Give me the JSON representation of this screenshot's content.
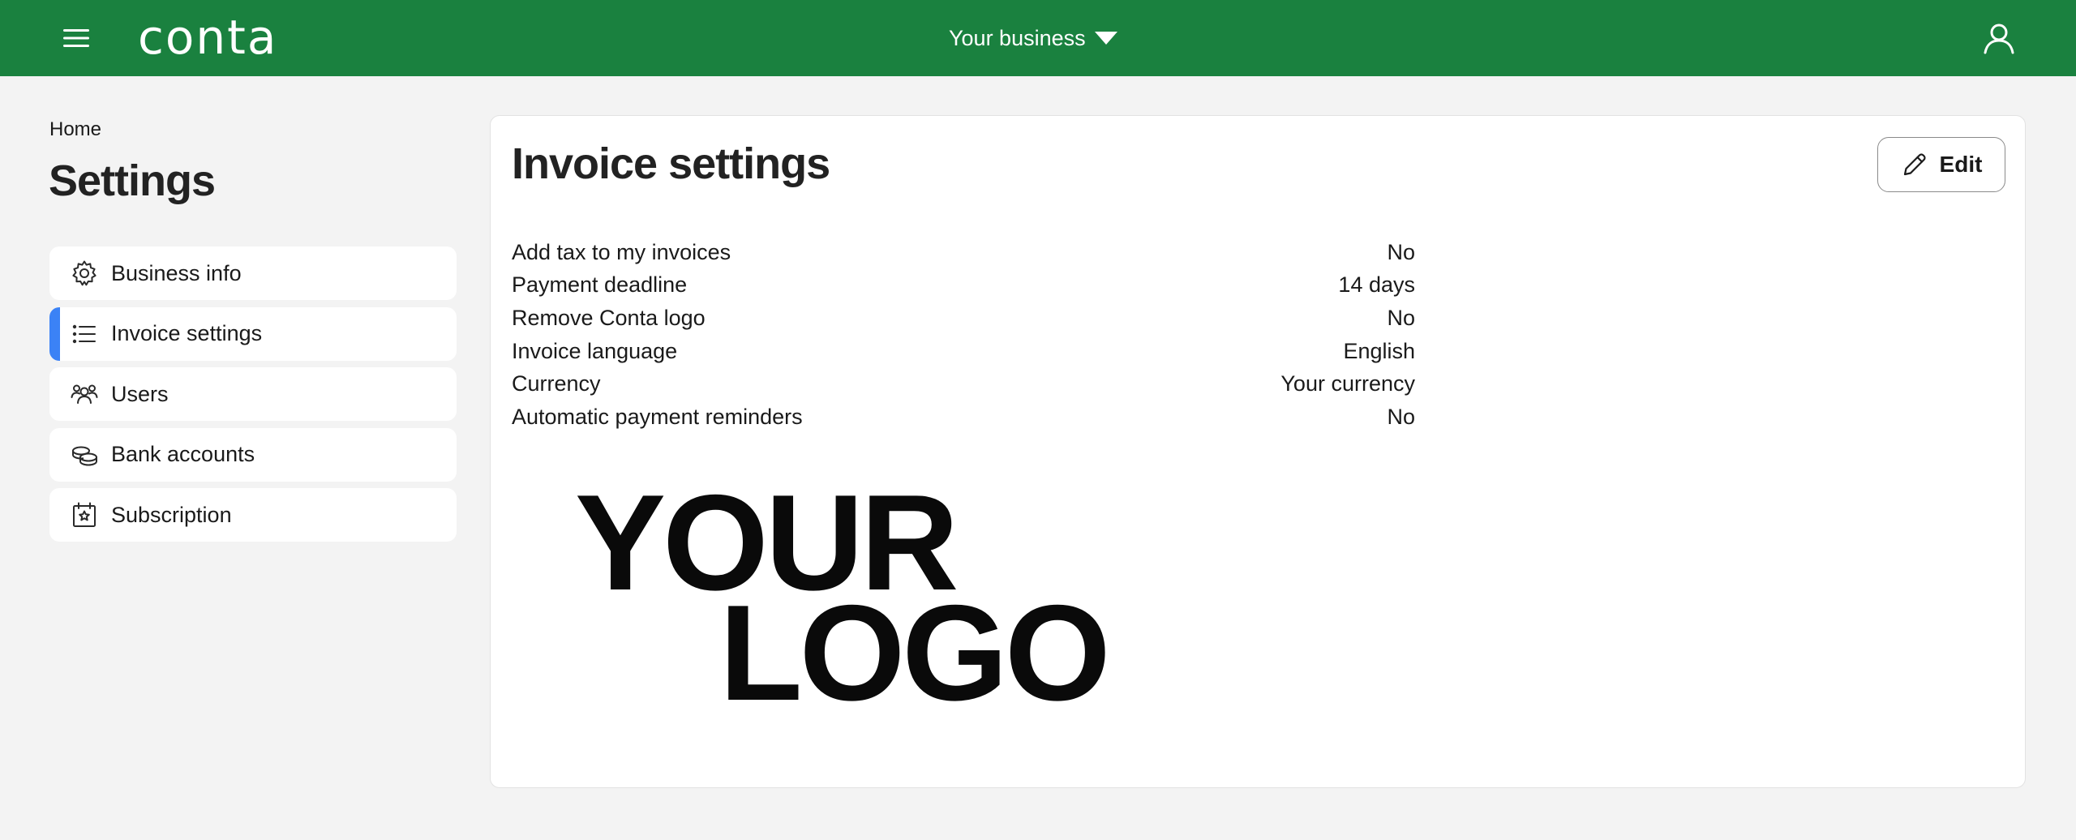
{
  "header": {
    "brand": "conta",
    "business_switch": "Your business",
    "icons": {
      "menu": "hamburger-icon",
      "dropdown": "caret-down-icon",
      "user": "user-icon"
    },
    "colors": {
      "bar": "#1a813f",
      "text": "#ffffff"
    }
  },
  "breadcrumb": "Home",
  "page_title": "Settings",
  "sidebar": {
    "active_color": "#3b82f6",
    "items": [
      {
        "label": "Business info",
        "icon": "gear-icon",
        "active": false
      },
      {
        "label": "Invoice settings",
        "icon": "list-icon",
        "active": true
      },
      {
        "label": "Users",
        "icon": "users-icon",
        "active": false
      },
      {
        "label": "Bank accounts",
        "icon": "coins-icon",
        "active": false
      },
      {
        "label": "Subscription",
        "icon": "calendar-star-icon",
        "active": false
      }
    ]
  },
  "invoice_settings": {
    "title": "Invoice settings",
    "edit_label": "Edit",
    "edit_icon": "pencil-icon",
    "rows": [
      {
        "label": "Add tax to my invoices",
        "value": "No"
      },
      {
        "label": "Payment deadline",
        "value": "14 days"
      },
      {
        "label": "Remove Conta logo",
        "value": "No"
      },
      {
        "label": "Invoice language",
        "value": "English"
      },
      {
        "label": "Currency",
        "value": "Your currency"
      },
      {
        "label": "Automatic payment reminders",
        "value": "No"
      }
    ],
    "logo_placeholder": {
      "line1": "YOUR",
      "line2": "LOGO"
    }
  }
}
